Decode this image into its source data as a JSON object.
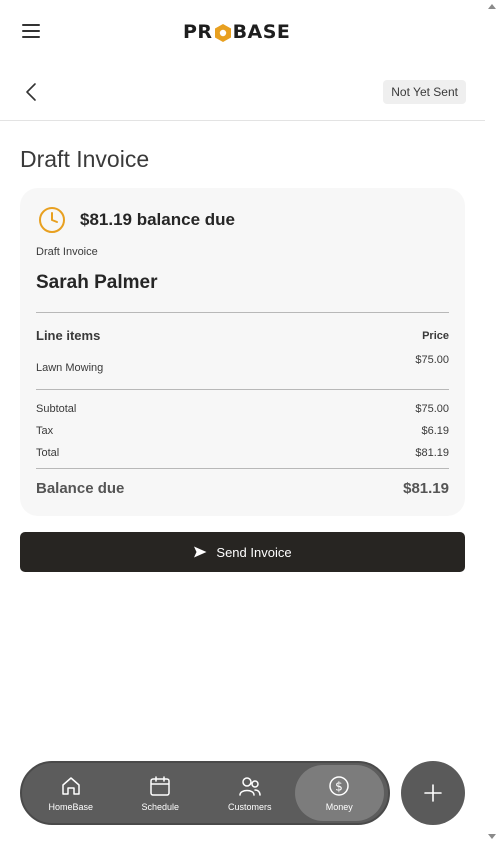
{
  "header": {
    "logo_left": "PR",
    "logo_right": "BASE",
    "status": "Not Yet Sent"
  },
  "page": {
    "title": "Draft Invoice"
  },
  "invoice": {
    "balance_heading": "$81.19 balance due",
    "label": "Draft Invoice",
    "customer": "Sarah Palmer",
    "line_items_header": "Line items",
    "price_header": "Price",
    "line_items": [
      {
        "name": "Lawn Mowing",
        "price": "$75.00"
      }
    ],
    "subtotal_label": "Subtotal",
    "subtotal_value": "$75.00",
    "tax_label": "Tax",
    "tax_value": "$6.19",
    "total_label": "Total",
    "total_value": "$81.19",
    "balance_label": "Balance due",
    "balance_value": "$81.19"
  },
  "actions": {
    "send_label": "Send Invoice"
  },
  "nav": {
    "items": [
      {
        "label": "HomeBase",
        "icon": "home-icon"
      },
      {
        "label": "Schedule",
        "icon": "calendar-icon"
      },
      {
        "label": "Customers",
        "icon": "users-icon"
      },
      {
        "label": "Money",
        "icon": "dollar-icon"
      }
    ],
    "active": "Money"
  },
  "colors": {
    "accent": "#e8a020",
    "dark": "#272522",
    "nav_bg": "#5c5c5c"
  }
}
